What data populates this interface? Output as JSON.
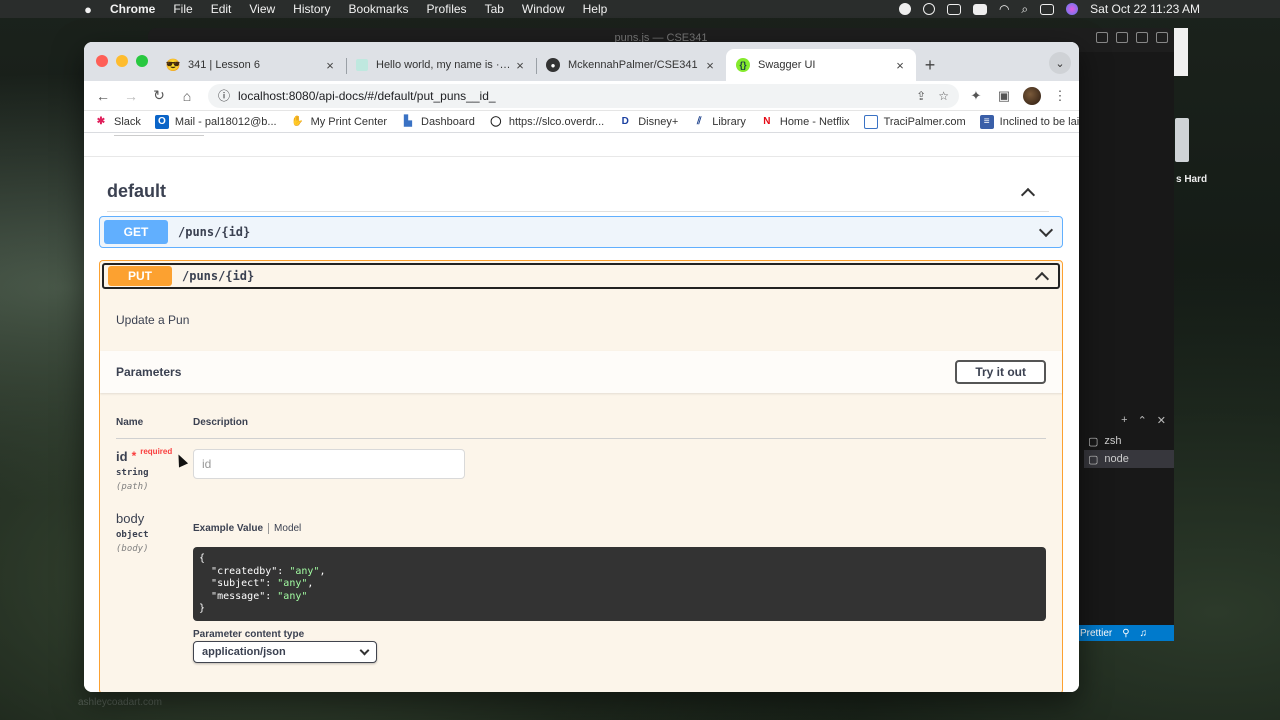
{
  "menubar": {
    "app": "Chrome",
    "items": [
      "File",
      "Edit",
      "View",
      "History",
      "Bookmarks",
      "Profiles",
      "Tab",
      "Window",
      "Help"
    ],
    "datetime": "Sat Oct 22  11:23 AM"
  },
  "background_window": {
    "title": "puns.js — CSE341",
    "hard_drive_label": "s Hard",
    "terminal_tabs": [
      "zsh",
      "node"
    ],
    "status_item": "Prettier"
  },
  "tabs": [
    {
      "icon": "sunglasses-emoji-icon",
      "label": "341 | Lesson 6"
    },
    {
      "icon": "doc-icon",
      "label": "Hello world, my name is · Web"
    },
    {
      "icon": "github-icon",
      "label": "MckennahPalmer/CSE341"
    },
    {
      "icon": "swagger-icon",
      "label": "Swagger UI",
      "active": true
    }
  ],
  "address_bar": {
    "url": "localhost:8080/api-docs/#/default/put_puns__id_"
  },
  "bookmarks": [
    {
      "icon": "slack-icon",
      "label": "Slack"
    },
    {
      "icon": "outlook-icon",
      "label": "Mail - pal18012@b..."
    },
    {
      "icon": "hand-icon",
      "label": "My Print Center"
    },
    {
      "icon": "dashboard-icon",
      "label": "Dashboard"
    },
    {
      "icon": "overdrive-icon",
      "label": "https://slco.overdr..."
    },
    {
      "icon": "disney-icon",
      "label": "Disney+"
    },
    {
      "icon": "library-icon",
      "label": "Library"
    },
    {
      "icon": "netflix-icon",
      "label": "Home - Netflix"
    },
    {
      "icon": "page-icon",
      "label": "TraciPalmer.com"
    },
    {
      "icon": "board-icon",
      "label": "Inclined to be laid..."
    }
  ],
  "swagger": {
    "section_title": "default",
    "get_op": {
      "method": "GET",
      "path": "/puns/{id}"
    },
    "put_op": {
      "method": "PUT",
      "path": "/puns/{id}",
      "description": "Update a Pun",
      "parameters_title": "Parameters",
      "try_button": "Try it out",
      "col_name": "Name",
      "col_description": "Description",
      "params": [
        {
          "name": "id",
          "required_label": "required",
          "type": "string",
          "in": "(path)",
          "placeholder": "id"
        },
        {
          "name": "body",
          "type": "object",
          "in": "(body)"
        }
      ],
      "example_tab": "Example Value",
      "model_tab": "Model",
      "example": {
        "open": "{",
        "k1": "\"createdby\"",
        "v1": "\"any\"",
        "k2": "\"subject\"",
        "v2": "\"any\"",
        "k3": "\"message\"",
        "v3": "\"any\"",
        "close": "}"
      },
      "content_type_label": "Parameter content type",
      "content_type_value": "application/json"
    }
  },
  "watermark": "ashleycoadart.com",
  "colors": {
    "get": "#61affe",
    "put": "#fca130",
    "put_bg": "#fcf5ea",
    "get_bg": "#eff5fb",
    "required": "#f93e3e"
  }
}
